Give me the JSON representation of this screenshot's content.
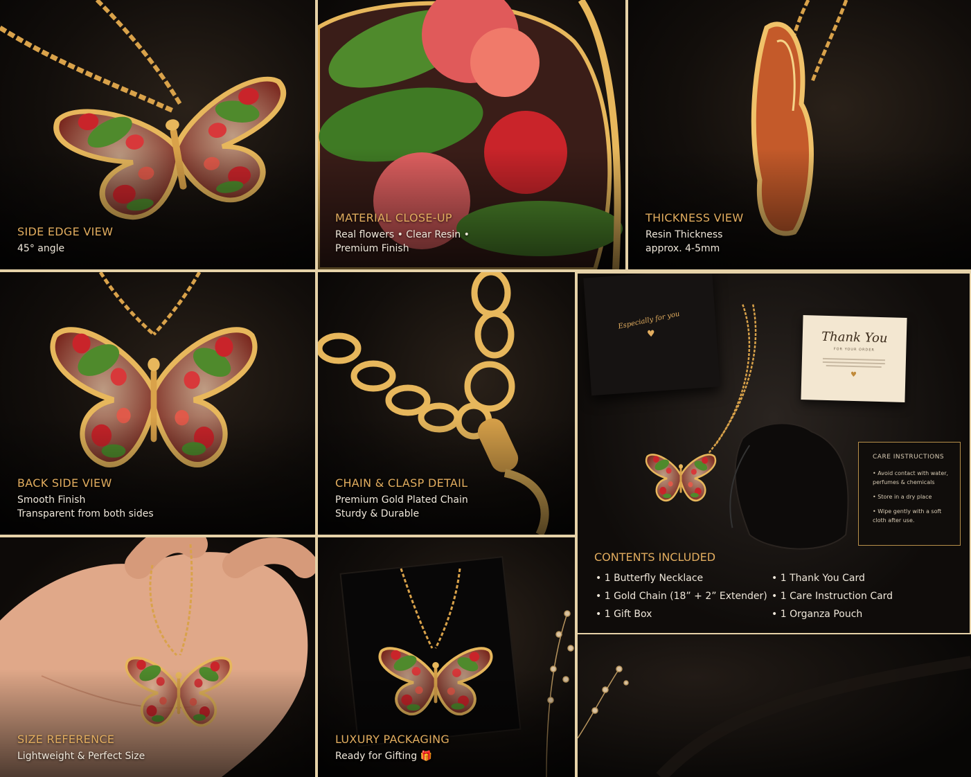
{
  "panels": [
    {
      "id": "side-edge",
      "title": "SIDE EDGE VIEW",
      "lines": [
        "45° angle"
      ]
    },
    {
      "id": "material",
      "title": "MATERIAL CLOSE-UP",
      "lines": [
        "Real flowers • Clear Resin •",
        "Premium Finish"
      ]
    },
    {
      "id": "thickness",
      "title": "THICKNESS VIEW",
      "lines": [
        "Resin Thickness",
        "approx. 4-5mm"
      ]
    },
    {
      "id": "back-side",
      "title": "BACK SIDE VIEW",
      "lines": [
        "Smooth Finish",
        "Transparent from both sides"
      ]
    },
    {
      "id": "chain-clasp",
      "title": "CHAIN & CLASP DETAIL",
      "lines": [
        "Premium Gold Plated Chain",
        "Sturdy & Durable"
      ]
    },
    {
      "id": "size-reference",
      "title": "SIZE REFERENCE",
      "lines": [
        "Lightweight & Perfect Size"
      ]
    },
    {
      "id": "packaging",
      "title": "LUXURY PACKAGING",
      "lines": [
        "Ready for Gifting 🎁"
      ]
    }
  ],
  "contents": {
    "title": "CONTENTS INCLUDED",
    "left_items": [
      "1 Butterfly Necklace",
      "1 Gold Chain (18” + 2” Extender)",
      "1 Gift Box"
    ],
    "right_items": [
      "1 Thank You Card",
      "1 Care Instruction Card",
      "1 Organza Pouch"
    ],
    "gift_box_text": "Especially for you",
    "thank_you": {
      "script": "Thank You",
      "sub": "FOR YOUR ORDER"
    },
    "care": {
      "title": "CARE INSTRUCTIONS",
      "items": [
        "Avoid contact with water, perfumes & chemicals",
        "Store in a dry place",
        "Wipe gently with a soft cloth after use."
      ]
    }
  },
  "colors": {
    "gold": "#e2ad5f",
    "frame": "#e6d2a8",
    "text": "#efe7da",
    "petal": "#c9242a",
    "leaf": "#4f8a2c"
  }
}
